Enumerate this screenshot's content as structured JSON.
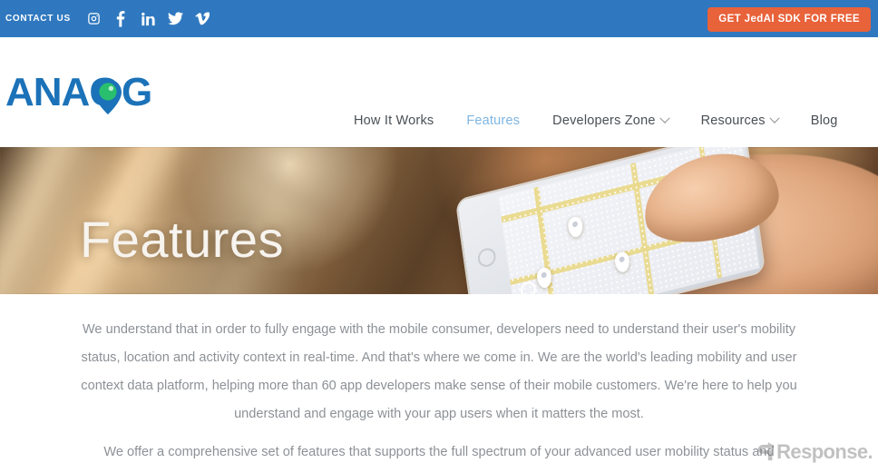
{
  "topbar": {
    "contact_label": "CONTACT US",
    "social": [
      {
        "name": "instagram-icon",
        "label": "Instagram"
      },
      {
        "name": "facebook-icon",
        "label": "Facebook"
      },
      {
        "name": "linkedin-icon",
        "label": "LinkedIn"
      },
      {
        "name": "twitter-icon",
        "label": "Twitter"
      },
      {
        "name": "vimeo-icon",
        "label": "Vimeo"
      }
    ],
    "cta_label": "GET JedAI SDK FOR FREE",
    "bar_color": "#2f78bf",
    "cta_color": "#e8623a"
  },
  "header": {
    "logo_text": "ANAGOG",
    "logo_blue": "#1b72b8",
    "logo_pin_green": "#29bf6e",
    "nav": [
      {
        "label": "How It Works",
        "active": false,
        "has_caret": false
      },
      {
        "label": "Features",
        "active": true,
        "has_caret": false
      },
      {
        "label": "Developers Zone",
        "active": false,
        "has_caret": true
      },
      {
        "label": "Resources",
        "active": false,
        "has_caret": true
      },
      {
        "label": "Blog",
        "active": false,
        "has_caret": false
      }
    ],
    "active_color": "#7fb5e0"
  },
  "hero": {
    "title": "Features"
  },
  "content": {
    "paragraph_1": "We understand that in order to fully engage with the mobile consumer, developers need to understand their user's mobility status, location and activity context in real-time. And that's where we come in. We are the world's leading mobility and user context data platform, helping more than 60 app developers make sense of their mobile customers. We're here to help you understand and engage with your app users when it matters the most.",
    "paragraph_2": "We offer a comprehensive set of features that supports the full spectrum of your advanced user mobility status and"
  },
  "watermark": {
    "text": "Response."
  }
}
